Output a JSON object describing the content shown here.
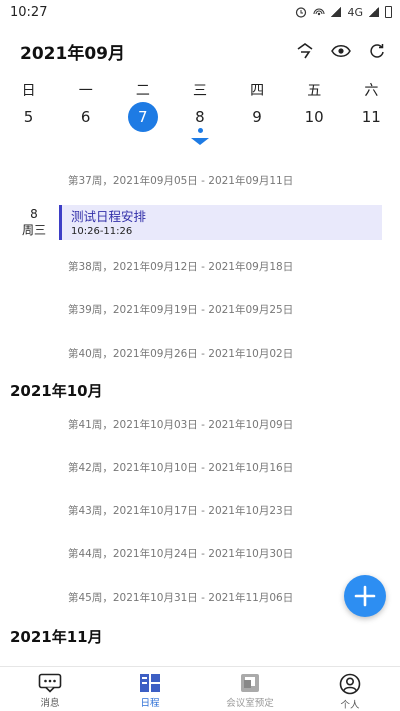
{
  "statusbar": {
    "time": "10:27",
    "network": "4G"
  },
  "header": {
    "month_title": "2021年09月"
  },
  "calendar": {
    "weekdays": [
      "日",
      "一",
      "二",
      "三",
      "四",
      "五",
      "六"
    ],
    "dates": [
      "5",
      "6",
      "7",
      "8",
      "9",
      "10",
      "11"
    ],
    "selected_date": "7"
  },
  "schedule": {
    "sep_weeks": [
      "第37周，2021年09月05日 - 2021年09月11日",
      "第38周，2021年09月12日 - 2021年09月18日",
      "第39周，2021年09月19日 - 2021年09月25日",
      "第40周，2021年09月26日 - 2021年10月02日"
    ],
    "event": {
      "day": "8",
      "weekday": "周三",
      "title": "测试日程安排",
      "time": "10:26-11:26"
    },
    "oct_label": "2021年10月",
    "oct_weeks": [
      "第41周，2021年10月03日 - 2021年10月09日",
      "第42周，2021年10月10日 - 2021年10月16日",
      "第43周，2021年10月17日 - 2021年10月23日",
      "第44周，2021年10月24日 - 2021年10月30日",
      "第45周，2021年10月31日 - 2021年11月06日"
    ],
    "nov_label": "2021年11月"
  },
  "tabs": [
    {
      "label": "消息",
      "icon": "message-icon"
    },
    {
      "label": "日程",
      "icon": "schedule-icon"
    },
    {
      "label": "会议室预定",
      "icon": "meeting-room-icon"
    },
    {
      "label": "个人",
      "icon": "person-icon"
    }
  ],
  "colors": {
    "accent": "#1e7be4",
    "event_bg": "#e9e9fb",
    "event_bar": "#3d3ec6",
    "fab": "#2d8ef2"
  }
}
